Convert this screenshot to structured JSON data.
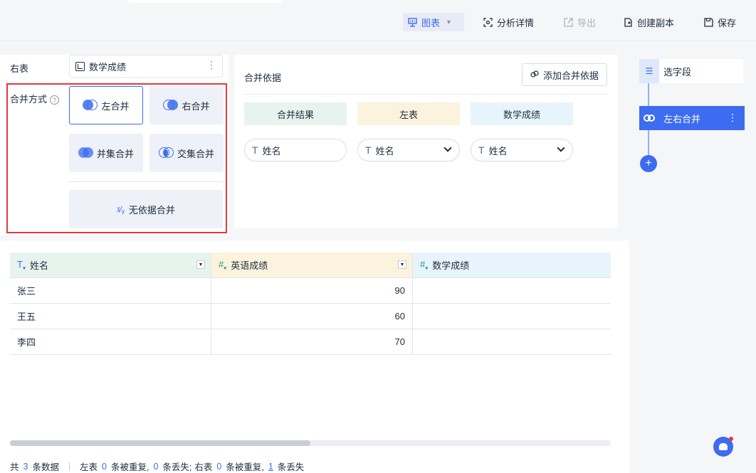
{
  "toolbar": {
    "chart_label": "图表",
    "analysis_label": "分析详情",
    "export_label": "导出",
    "duplicate_label": "创建副本",
    "save_label": "保存"
  },
  "config": {
    "right_table_label": "右表",
    "right_table_value": "数学成绩",
    "join_mode_label": "合并方式",
    "help_glyph": "?",
    "modes": {
      "left": "左合并",
      "right": "右合并",
      "union": "并集合并",
      "intersect": "交集合并",
      "cross": "无依据合并"
    },
    "selected_mode": "left"
  },
  "basis": {
    "title": "合并依据",
    "add_button": "添加合并依据",
    "headers": [
      "合并结果",
      "左表",
      "数学成绩"
    ],
    "fields": [
      "姓名",
      "姓名",
      "姓名"
    ],
    "field_type_glyph": "T"
  },
  "grid": {
    "columns": [
      {
        "type": "T",
        "name": "姓名"
      },
      {
        "type": "#",
        "name": "英语成绩"
      },
      {
        "type": "#",
        "name": "数学成绩"
      }
    ],
    "rows": [
      [
        "张三",
        "90",
        ""
      ],
      [
        "王五",
        "60",
        ""
      ],
      [
        "李四",
        "70",
        ""
      ]
    ]
  },
  "footer": {
    "total_prefix": "共",
    "total_count": "3",
    "total_suffix": "条数据",
    "left_label": "左表",
    "left_dup": "0",
    "dup_text": "条被重复,",
    "left_lost": "0",
    "lost_text_1": "条丢失;",
    "right_label": "右表",
    "right_dup": "0",
    "dup_text_2": "条被重复,",
    "right_lost": "1",
    "lost_text_2": "条丢失"
  },
  "flow": {
    "step1": "选字段",
    "step2": "左右合并",
    "add": "+"
  },
  "colors": {
    "accent": "#3d6cf0",
    "highlight_border": "#e5383b",
    "header_text_col": "#e7f4ee",
    "header_num_col_1": "#fbf3de",
    "header_num_col_2": "#e7f4fb"
  }
}
